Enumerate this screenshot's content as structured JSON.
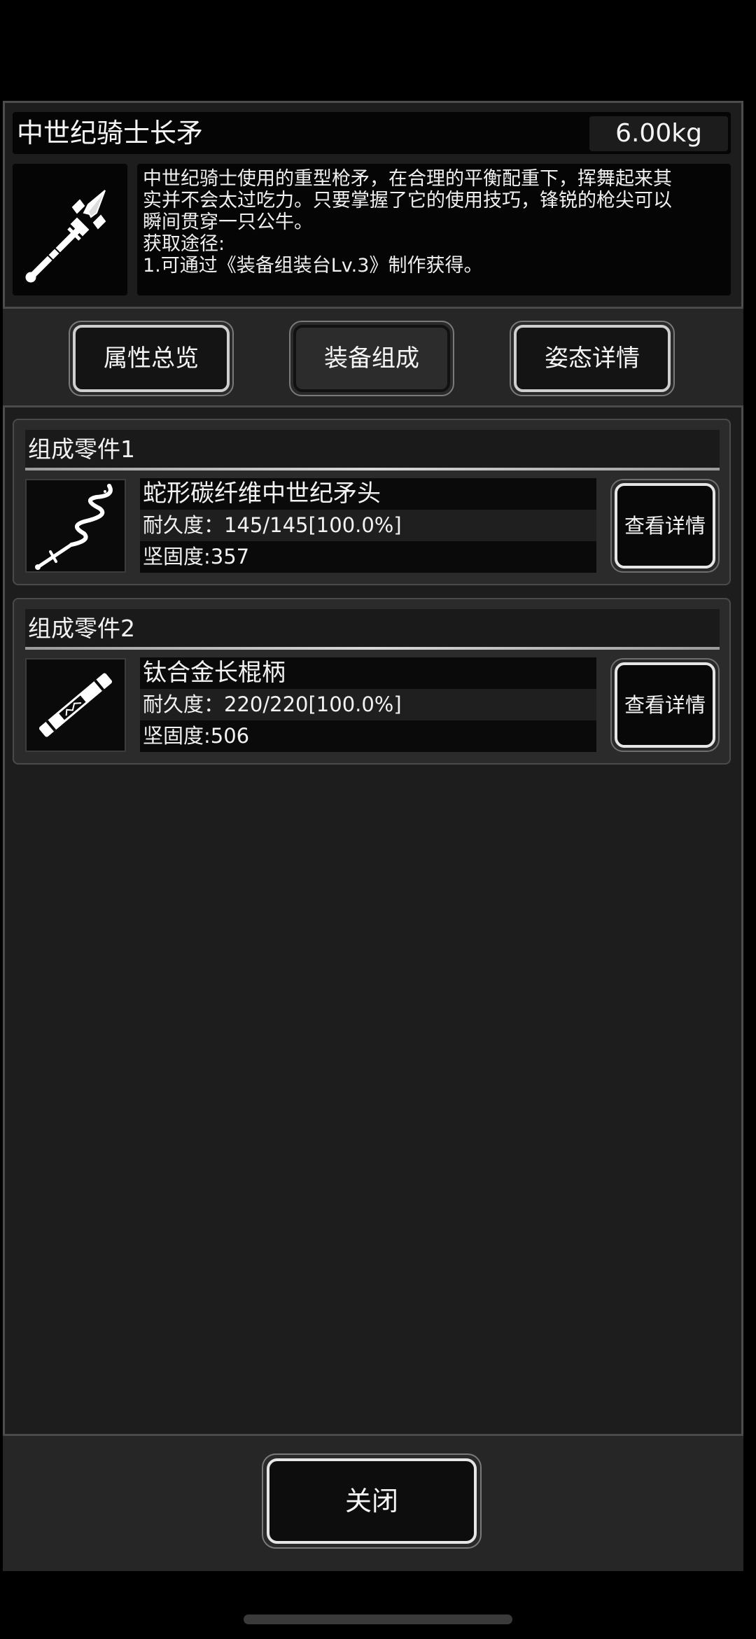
{
  "item": {
    "name": "中世纪骑士长矛",
    "weight": "6.00kg",
    "icon": "spear-icon",
    "description_lines": [
      "中世纪骑士使用的重型枪矛，在合理的平衡配重下，挥舞起来其",
      "实并不会太过吃力。只要掌握了它的使用技巧，锋锐的枪尖可以",
      "瞬间贯穿一只公牛。",
      "获取途径:",
      "1.可通过《装备组装台Lv.3》制作获得。"
    ]
  },
  "tabs": [
    {
      "label": "属性总览",
      "active": false
    },
    {
      "label": "装备组成",
      "active": true
    },
    {
      "label": "姿态详情",
      "active": false
    }
  ],
  "parts": [
    {
      "header": "组成零件1",
      "name": "蛇形碳纤维中世纪矛头",
      "durability": "耐久度：145/145[100.0%]",
      "hardness": "坚固度:357",
      "icon": "serpent-spearhead-icon",
      "detail_label": "查看详情"
    },
    {
      "header": "组成零件2",
      "name": "钛合金长棍柄",
      "durability": "耐久度：220/220[100.0%]",
      "hardness": "坚固度:506",
      "icon": "staff-handle-icon",
      "detail_label": "查看详情"
    }
  ],
  "footer": {
    "close_label": "关闭"
  },
  "colors": {
    "background": "#000000",
    "panel": "#1d1d1d",
    "bar": "#262626",
    "text": "#f2f2f2",
    "button_border": "#e6e6e6"
  }
}
